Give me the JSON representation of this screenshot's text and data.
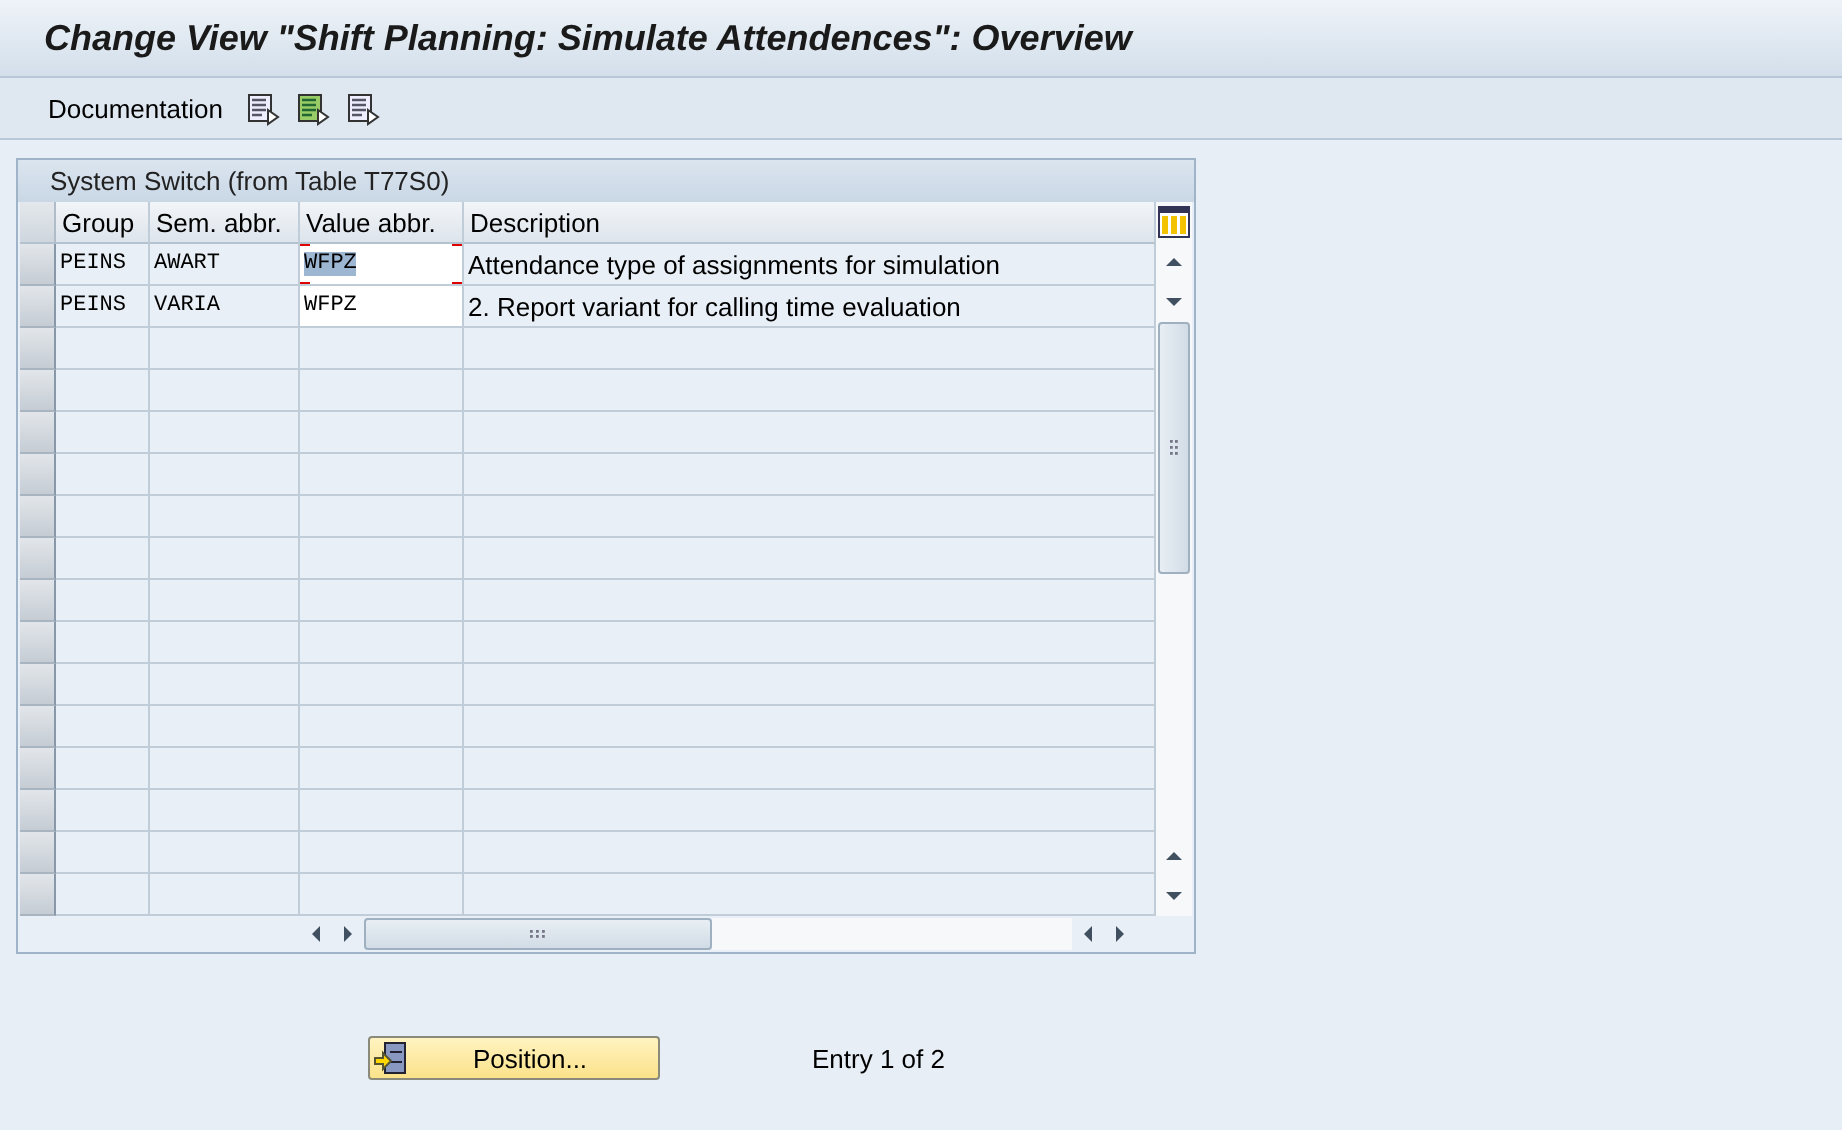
{
  "window": {
    "title": "Change View \"Shift Planning: Simulate Attendences\": Overview"
  },
  "toolbar": {
    "items": [
      {
        "kind": "text",
        "label": "Documentation"
      },
      {
        "kind": "icon"
      },
      {
        "kind": "icon"
      },
      {
        "kind": "icon"
      }
    ]
  },
  "table": {
    "title": "System Switch (from Table T77S0)",
    "columns": [
      "Group",
      "Sem. abbr.",
      "Value abbr.",
      "Description"
    ],
    "rows": [
      {
        "group": "PEINS",
        "sem_abbr": "AWART",
        "value_abbr": "WFPZ",
        "description": "Attendance type of assignments for simulation",
        "focused": true
      },
      {
        "group": "PEINS",
        "sem_abbr": "VARIA",
        "value_abbr": "WFPZ",
        "description": "2. Report variant for calling time evaluation",
        "focused": false
      }
    ]
  },
  "position_button": {
    "label": "Position..."
  },
  "entry_info": "Entry 1 of 2"
}
